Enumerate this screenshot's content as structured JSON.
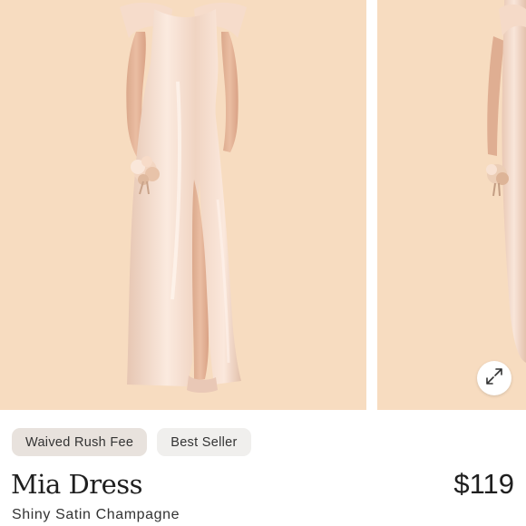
{
  "product": {
    "name": "Mia Dress",
    "variant": "Shiny Satin Champagne",
    "price": "$119"
  },
  "badges": [
    {
      "label": "Waived Rush Fee"
    },
    {
      "label": "Best Seller"
    }
  ],
  "gallery": {
    "images": [
      {
        "alt": "model wearing champagne satin dress front view"
      },
      {
        "alt": "model wearing champagne satin dress side view"
      }
    ],
    "zoom_icon": "expand-arrows-icon"
  },
  "colors": {
    "photo_background": "#f7dcc0",
    "dress": "#f1d6c4",
    "badge_rush": "#e8e2dd",
    "badge_seller": "#f0efed",
    "text": "#1f1f1f"
  }
}
